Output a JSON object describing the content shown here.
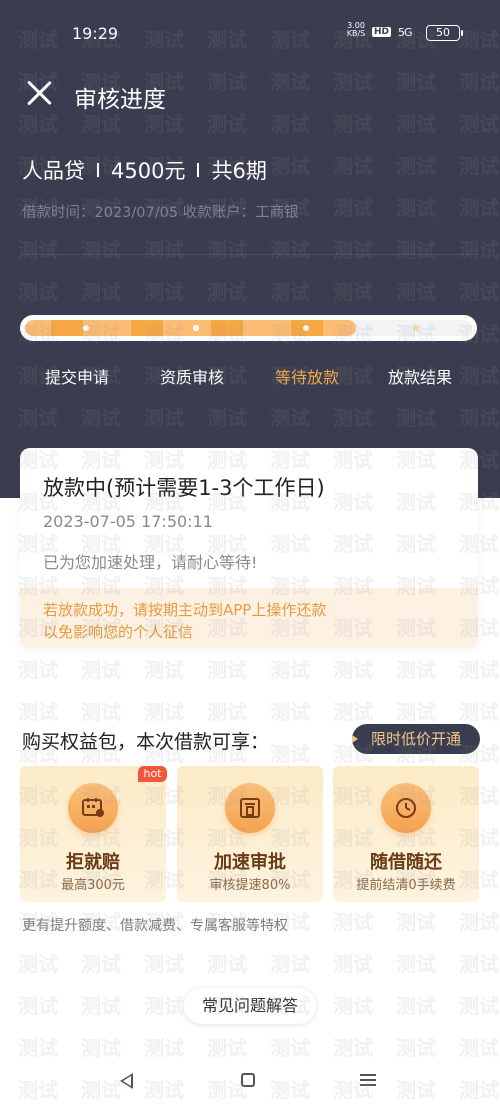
{
  "status_bar": {
    "time": "19:29",
    "net_speed": "3.00",
    "net_unit": "KB/S",
    "hd": "HD",
    "signal": "5G",
    "battery": "50"
  },
  "nav": {
    "title": "审核进度"
  },
  "loan": {
    "product": "人品贷",
    "amount": "4500元",
    "term": "共6期",
    "meta": "借款时间：2023/07/05  收款账户：工商银"
  },
  "progress": {
    "fraction": 0.74
  },
  "steps": [
    {
      "label": "提交申请",
      "active": false
    },
    {
      "label": "资质审核",
      "active": false
    },
    {
      "label": "等待放款",
      "active": true
    },
    {
      "label": "放款结果",
      "active": false
    }
  ],
  "status_card": {
    "title": "放款中(预计需要1-3个工作日)",
    "time": "2023-07-05 17:50:11",
    "message": "已为您加速处理，请耐心等待!",
    "notice_line1": "若放款成功，请按期主动到APP上操作还款",
    "notice_line2": "以免影响您的个人征信"
  },
  "benefits": {
    "title": "购买权益包，本次借款可享：",
    "promo_label": "限时低价开通",
    "hot_badge": "hot",
    "items": [
      {
        "name": "拒就赔",
        "desc": "最高300元",
        "icon": "calendar-card-icon"
      },
      {
        "name": "加速审批",
        "desc": "审核提速80%",
        "icon": "document-stamp-icon"
      },
      {
        "name": "随借随还",
        "desc": "提前结清0手续费",
        "icon": "clock-icon"
      }
    ],
    "more_text": "更有提升额度、借款减费、专属客服等特权"
  },
  "faq": {
    "label": "常见问题解答"
  },
  "watermark": "测试",
  "colors": {
    "header_bg": "#3a3d4f",
    "accent": "#f4a84a",
    "notice_bg": "#fdf1e4",
    "notice_text": "#e89a3c",
    "hot": "#f2563d"
  }
}
